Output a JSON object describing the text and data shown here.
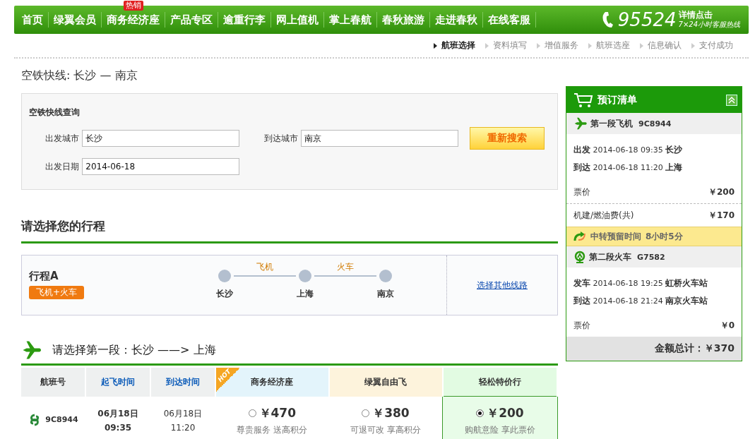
{
  "nav": {
    "items": [
      {
        "label": "首页"
      },
      {
        "label": "绿翼会员"
      },
      {
        "label": "商务经济座",
        "badge": "热销"
      },
      {
        "label": "产品专区"
      },
      {
        "label": "逾重行李"
      },
      {
        "label": "网上值机"
      },
      {
        "label": "掌上春航"
      },
      {
        "label": "春秋旅游"
      },
      {
        "label": "走进春秋"
      },
      {
        "label": "在线客服"
      }
    ],
    "hotline": {
      "number": "95524",
      "link": "详情点击",
      "caption": "7×24小时客服热线"
    }
  },
  "steps": [
    {
      "label": "航班选择",
      "selected": true
    },
    {
      "label": "资料填写",
      "selected": false
    },
    {
      "label": "增值服务",
      "selected": false
    },
    {
      "label": "航班选座",
      "selected": false
    },
    {
      "label": "信息确认",
      "selected": false
    },
    {
      "label": "支付成功",
      "selected": false
    }
  ],
  "page_title": "空铁快线: 长沙 — 南京",
  "search": {
    "heading": "空铁快线查询",
    "fields": [
      {
        "label": "出发城市",
        "value": "长沙"
      },
      {
        "label": "到达城市",
        "value": "南京"
      },
      {
        "label": "出发日期",
        "value": "2014-06-18"
      }
    ],
    "button": "重新搜索"
  },
  "itinerary": {
    "heading": "请选择您的行程",
    "name": "行程A",
    "tag": "飞机+火车",
    "stops": [
      "长沙",
      "上海",
      "南京"
    ],
    "legs": [
      "飞机",
      "火车"
    ],
    "link": "选择其他线路"
  },
  "segment": {
    "heading": "请选择第一段：长沙 ——> 上海",
    "columns": [
      {
        "label": "航班号",
        "kind": "plain"
      },
      {
        "label": "起飞时间",
        "kind": "sort"
      },
      {
        "label": "到达时间",
        "kind": "sort"
      },
      {
        "label": "商务经济座",
        "kind": "fare",
        "badge": "HOT"
      },
      {
        "label": "绿翼自由飞",
        "kind": "fare"
      },
      {
        "label": "轻松特价行",
        "kind": "fare"
      }
    ],
    "rows": [
      {
        "flight": "9C8944",
        "dep_date": "06月18日",
        "dep_time": "09:35",
        "arr_date": "06月18日",
        "arr_time": "11:20",
        "fares": [
          {
            "price": "￥470",
            "note": "尊贵服务 送高积分",
            "selected": false
          },
          {
            "price": "￥380",
            "note": "可退可改 享高积分",
            "selected": false
          },
          {
            "price": "￥200",
            "note": "购航意险 享此票价",
            "selected": true
          }
        ]
      }
    ]
  },
  "cart": {
    "title": "预订清单",
    "sections": [
      {
        "kind": "flight",
        "heading": "第一段飞机",
        "code": "9C8944",
        "lines": [
          {
            "label": "出发",
            "time": "2014-06-18 09:35",
            "place": "长沙"
          },
          {
            "label": "到达",
            "time": "2014-06-18 11:20",
            "place": "上海"
          }
        ],
        "fees": [
          {
            "label": "票价",
            "amount": "￥200"
          },
          {
            "label": "机建/燃油费(共)",
            "amount": "￥170"
          }
        ]
      },
      {
        "kind": "transfer",
        "heading": "中转预留时间",
        "code": "8小时5分"
      },
      {
        "kind": "train",
        "heading": "第二段火车",
        "code": "G7582",
        "lines": [
          {
            "label": "发车",
            "time": "2014-06-18 19:25",
            "place": "虹桥火车站"
          },
          {
            "label": "到达",
            "time": "2014-06-18 21:24",
            "place": "南京火车站"
          }
        ],
        "fees": [
          {
            "label": "票价",
            "amount": "￥0"
          }
        ]
      }
    ],
    "total": "金额总计：￥370"
  }
}
